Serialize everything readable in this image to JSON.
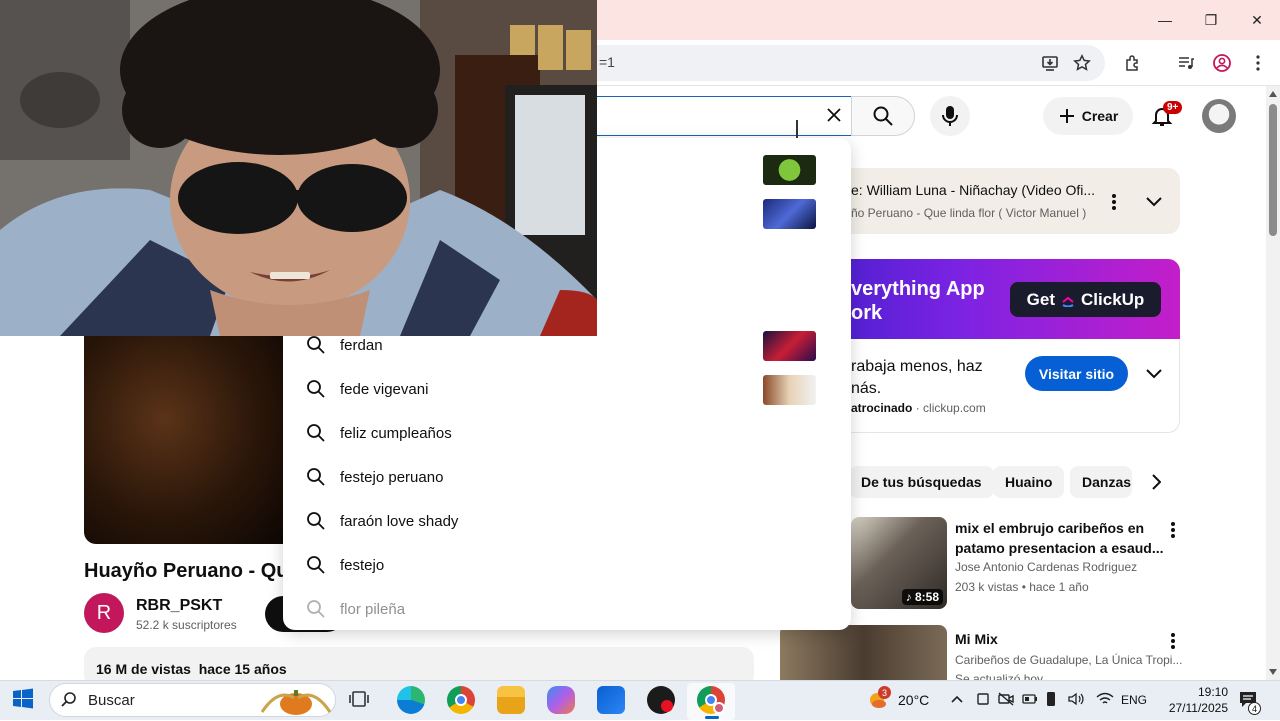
{
  "browser": {
    "url_fragment": "=1",
    "window_buttons": {
      "minimize": "—",
      "restore": "❐",
      "close": "✕"
    }
  },
  "header": {
    "create_label": "Crear",
    "notifications_badge": "9+"
  },
  "search": {
    "suggestions": [
      "ferdan",
      "fede vigevani",
      "feliz cumpleaños",
      "festejo peruano",
      "faraón love shady",
      "festejo",
      "flor pileña"
    ]
  },
  "sidebar": {
    "playlist": {
      "title": "e: William Luna - Niñachay (Video Ofi...",
      "next": "ño Peruano - Que linda flor ( Victor Manuel )"
    },
    "ad": {
      "banner_line1": "verything App",
      "banner_line2": "ork",
      "banner_button": "Get",
      "banner_brand": "ClickUp",
      "text_line1": "rabaja menos, haz",
      "text_line2": "nás.",
      "sponsored": "atrocinado",
      "domain": "clickup.com",
      "cta": "Visitar sitio"
    },
    "chips": [
      "De tus búsquedas",
      "Huaino",
      "Danzas"
    ],
    "videos": [
      {
        "title_line1": "mix el embrujo caribeños en",
        "title_line2": "patamo presentacion a  esaud...",
        "channel": "Jose Antonio Cardenas Rodriguez",
        "meta": "203 k vistas • hace 1 año",
        "duration": "8:58"
      },
      {
        "title_line1": "Mi Mix",
        "title_line2": "",
        "channel": "Caribeños de Guadalupe, La Única Tropi...",
        "meta": "Se actualizó hoy",
        "duration": ""
      }
    ]
  },
  "main": {
    "title": "Huayño Peruano - Que",
    "channel_initial": "R",
    "channel_name": "RBR_PSKT",
    "subscribers": "52.2 k suscriptores",
    "views_date": "16 M de vistas  hace 15 años"
  },
  "taskbar": {
    "search_placeholder": "Buscar",
    "weather_badge": "3",
    "temperature": "20°C",
    "language": "ENG",
    "time": "19:10",
    "date": "27/11/2025",
    "notification_count": "4"
  },
  "colors": {
    "accent_blue": "#065fd4",
    "youtube_red": "#cc0000",
    "ad_gradient_start": "#3b1fc8",
    "ad_gradient_end": "#c41ec9"
  }
}
